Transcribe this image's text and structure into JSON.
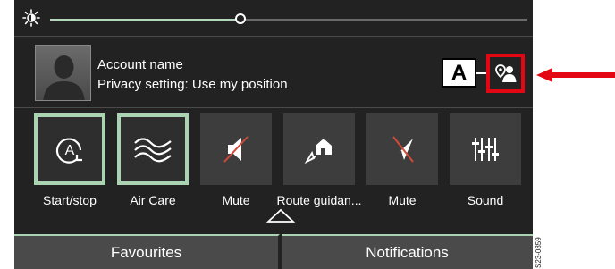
{
  "slider": {
    "level_percent": 40
  },
  "account": {
    "name": "Account name",
    "privacy": "Privacy setting: Use my position"
  },
  "callout": {
    "letter": "A",
    "arrow_color": "#e30613"
  },
  "tiles": [
    {
      "label": "Start/stop",
      "icon": "auto-start-stop-icon",
      "active": true
    },
    {
      "label": "Air Care",
      "icon": "air-care-icon",
      "active": true
    },
    {
      "label": "Mute",
      "icon": "mute-speaker-icon",
      "active": false
    },
    {
      "label": "Route guidan...",
      "icon": "route-guidance-home-icon",
      "active": false
    },
    {
      "label": "Mute",
      "icon": "mute-navigation-icon",
      "active": false
    },
    {
      "label": "Sound",
      "icon": "sound-equalizer-icon",
      "active": false
    }
  ],
  "tabs": {
    "favourites": "Favourites",
    "notifications": "Notifications"
  },
  "figure_code": "S23-0859",
  "colors": {
    "accent": "#a9d3b1",
    "panel": "#222222",
    "highlight": "#e30613"
  }
}
